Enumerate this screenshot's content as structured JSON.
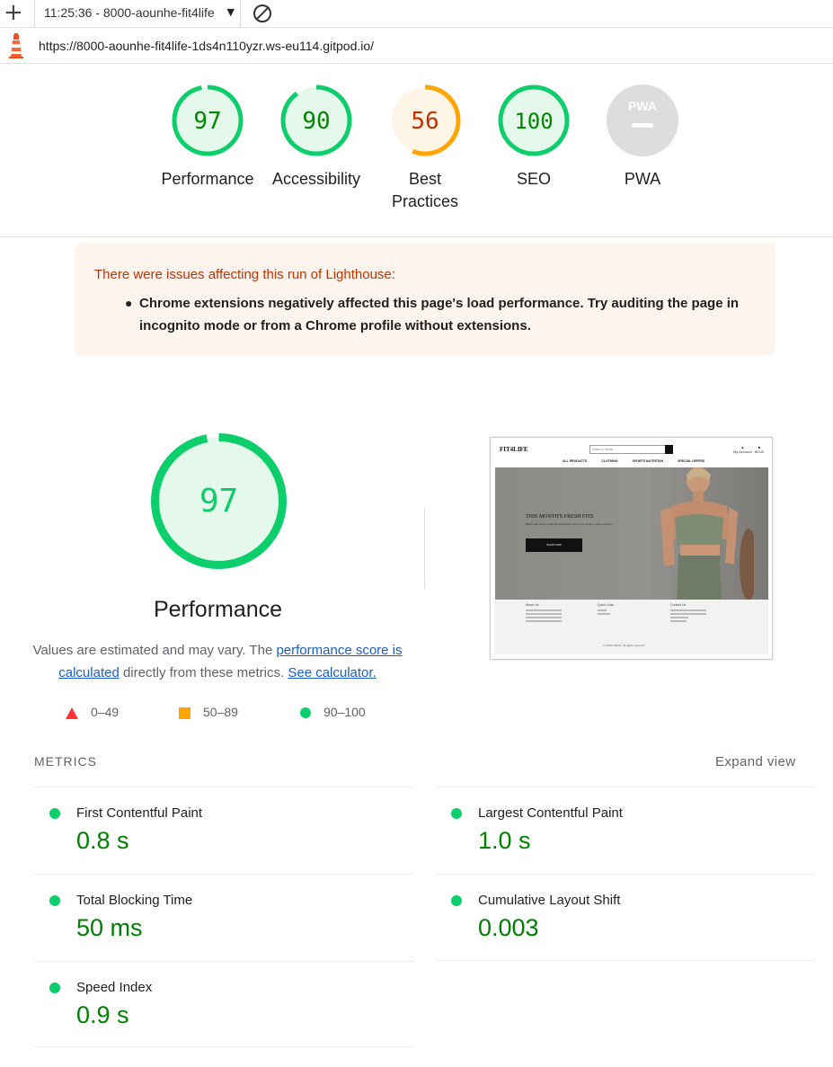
{
  "topbar": {
    "tab_title": "11:25:36 - 8000-aounhe-fit4life",
    "url": "https://8000-aounhe-fit4life-1ds4n110yzr.ws-eu114.gitpod.io/"
  },
  "gauges": [
    {
      "label": "Performance",
      "score": "97",
      "value": 0.97,
      "status": "pass"
    },
    {
      "label": "Accessibility",
      "score": "90",
      "value": 0.9,
      "status": "pass"
    },
    {
      "label": "Best Practices",
      "score": "56",
      "value": 0.56,
      "status": "average"
    },
    {
      "label": "SEO",
      "score": "100",
      "value": 1.0,
      "status": "pass"
    },
    {
      "label": "PWA",
      "score": "PWA",
      "status": "na"
    }
  ],
  "colors": {
    "pass": "#0cce6b",
    "pass_text": "#008800",
    "pass_bg": "#e5f8ec",
    "average": "#ffa400",
    "average_text": "#c33300",
    "average_bg": "#fff5e6",
    "fail": "#ff3333",
    "na": "#cccccc"
  },
  "warning": {
    "title": "There were issues affecting this run of Lighthouse:",
    "item": "Chrome extensions negatively affected this page's load performance. Try auditing the page in incognito mode or from a Chrome profile without extensions."
  },
  "performance": {
    "score": "97",
    "value": 0.97,
    "title": "Performance",
    "desc_pre": "Values are estimated and may vary. The ",
    "desc_link1": "performance score is calculated",
    "desc_mid": " directly from these metrics. ",
    "desc_link2": "See calculator."
  },
  "legend": [
    {
      "shape": "triangle",
      "range": "0–49"
    },
    {
      "shape": "square",
      "range": "50–89"
    },
    {
      "shape": "circle",
      "range": "90–100"
    }
  ],
  "thumbnail": {
    "logo": "FIT4LIFE",
    "search_placeholder": "Search Store",
    "account": "My Account",
    "bag": "$0.00",
    "nav": [
      "ALL PRODUCTS",
      "CLOTHING",
      "SPORTS NUTRITION",
      "SPECIAL OFFERS"
    ],
    "hero_title": "THIS MONTH'S FRESH FITS",
    "hero_sub": "Brand new drops, fresh fits designed to push your limits in every session",
    "hero_button": "SHOP NOW",
    "footer_about": "About Us",
    "footer_links": "Quick Links",
    "footer_contact": "Contact Us",
    "copyright": "© 2023 Fit4Life. All rights reserved."
  },
  "metrics": {
    "heading": "METRICS",
    "expand": "Expand view",
    "items": [
      {
        "label": "First Contentful Paint",
        "value": "0.8 s"
      },
      {
        "label": "Largest Contentful Paint",
        "value": "1.0 s"
      },
      {
        "label": "Total Blocking Time",
        "value": "50 ms"
      },
      {
        "label": "Cumulative Layout Shift",
        "value": "0.003"
      },
      {
        "label": "Speed Index",
        "value": "0.9 s"
      }
    ]
  }
}
